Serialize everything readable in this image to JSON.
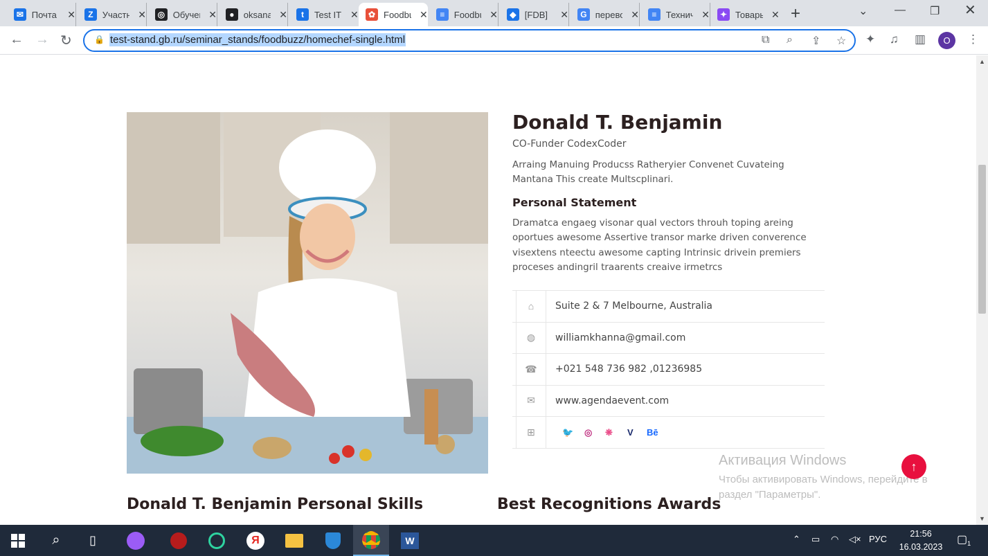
{
  "browser": {
    "tabs": [
      {
        "title": "Почта",
        "color": "#1a73e8",
        "glyph": "✉"
      },
      {
        "title": "Участники",
        "color": "#1a73e8",
        "glyph": "Z"
      },
      {
        "title": "Обучение",
        "color": "#202124",
        "glyph": "◎"
      },
      {
        "title": "oksana",
        "color": "#202124",
        "glyph": "●"
      },
      {
        "title": "Test IT",
        "color": "#1a73e8",
        "glyph": "t"
      },
      {
        "title": "Foodbuzz",
        "color": "#e8503a",
        "glyph": "✿"
      },
      {
        "title": "Foodbuzz",
        "color": "#4285f4",
        "glyph": "≡"
      },
      {
        "title": "[FDB]",
        "color": "#1a73e8",
        "glyph": "◆"
      },
      {
        "title": "перевод",
        "color": "#4285f4",
        "glyph": "G"
      },
      {
        "title": "Техническое",
        "color": "#4285f4",
        "glyph": "≡"
      },
      {
        "title": "Товары",
        "color": "#8a4af3",
        "glyph": "✦"
      }
    ],
    "address": "test-stand.gb.ru/seminar_stands/foodbuzz/homechef-single.html",
    "profile_initial": "O"
  },
  "profile": {
    "name": "Donald T. Benjamin",
    "role": "CO-Funder CodexCoder",
    "bio": "Arraing Manuing Producss Ratheryier Convenet Cuvateing Mantana This create Multscplinari.",
    "statement_title": "Personal Statement",
    "statement": "Dramatca engaeg visonar qual vectors throuh toping areing oportues awesome Assertive transor marke driven converence visextens nteectu awesome capting Intrinsic drivein premiers proceses andingril traarents creaive irmetrcs"
  },
  "contact": {
    "address": "Suite 2 & 7 Melbourne, Australia",
    "email": "williamkhanna@gmail.com",
    "phone": "+021 548 736 982 ,01236985",
    "website": "www.agendaevent.com",
    "social": [
      {
        "name": "twitter-icon",
        "glyph": "🐦",
        "color": "#1da1f2"
      },
      {
        "name": "instagram-icon",
        "glyph": "◎",
        "color": "#c13584"
      },
      {
        "name": "dribbble-icon",
        "glyph": "❋",
        "color": "#ea4c89"
      },
      {
        "name": "vimeo-icon",
        "glyph": "V",
        "color": "#1a2a6c"
      },
      {
        "name": "behance-icon",
        "glyph": "Bē",
        "color": "#1769ff"
      }
    ]
  },
  "sections": {
    "skills_title": "Donald T. Benjamin Personal Skills",
    "awards_title": "Best Recognitions Awards"
  },
  "watermark": {
    "title": "Активация Windows",
    "text": "Чтобы активировать Windows, перейдите в раздел \"Параметры\"."
  },
  "taskbar": {
    "lang": "РУС",
    "time": "21:56",
    "date": "16.03.2023",
    "notifications": "1"
  }
}
